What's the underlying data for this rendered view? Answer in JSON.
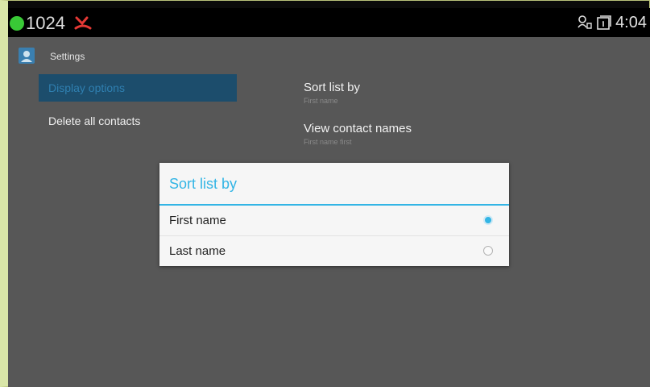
{
  "status_bar": {
    "extension": "1024",
    "time": "4:04",
    "status_color": "#39c936"
  },
  "app": {
    "title": "Settings"
  },
  "sidebar": {
    "items": [
      {
        "label": "Display options",
        "selected": true
      },
      {
        "label": "Delete all contacts",
        "selected": false
      }
    ]
  },
  "preferences": [
    {
      "title": "Sort list by",
      "summary": "First name"
    },
    {
      "title": "View contact names",
      "summary": "First name first"
    }
  ],
  "dialog": {
    "title": "Sort list by",
    "options": [
      {
        "label": "First name",
        "checked": true
      },
      {
        "label": "Last name",
        "checked": false
      }
    ],
    "accent": "#33b5e5"
  },
  "icons": {
    "status": "status-dot-icon",
    "missed_call": "missed-call-icon",
    "app": "contacts-icon",
    "notifications": [
      "voicemail-icon",
      "screen-icon"
    ]
  }
}
